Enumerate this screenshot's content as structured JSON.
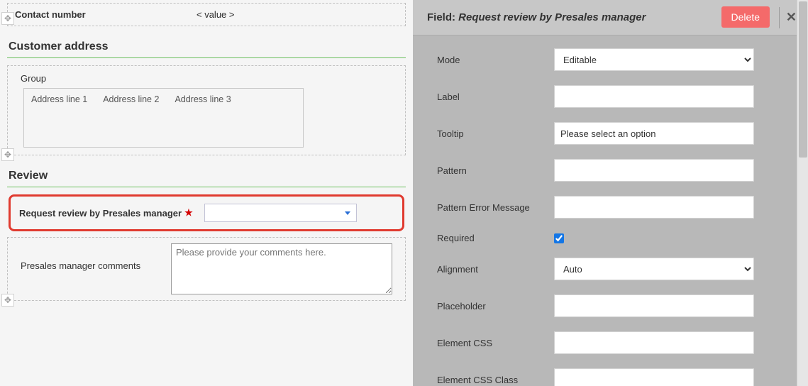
{
  "form": {
    "contact": {
      "label": "Contact number",
      "value_placeholder": "< value >"
    },
    "addr_section": {
      "title": "Customer address",
      "group_label": "Group",
      "lines": [
        "Address line 1",
        "Address line 2",
        "Address line 3"
      ]
    },
    "review_section": {
      "title": "Review",
      "request_label": "Request review by Presales manager",
      "comments_label": "Presales manager comments",
      "comments_placeholder": "Please provide your comments here."
    }
  },
  "props": {
    "title_prefix": "Field: ",
    "title_value": "Request review by Presales manager",
    "delete_label": "Delete",
    "rows": {
      "mode": {
        "label": "Mode",
        "value": "Editable"
      },
      "label": {
        "label": "Label",
        "value": ""
      },
      "tooltip": {
        "label": "Tooltip",
        "value": "Please select an option"
      },
      "pattern": {
        "label": "Pattern",
        "value": ""
      },
      "pattern_err": {
        "label": "Pattern Error Message",
        "value": ""
      },
      "required": {
        "label": "Required",
        "checked": true
      },
      "alignment": {
        "label": "Alignment",
        "value": "Auto"
      },
      "placeholder": {
        "label": "Placeholder",
        "value": ""
      },
      "element_css": {
        "label": "Element CSS",
        "value": ""
      },
      "element_css_class": {
        "label": "Element CSS Class",
        "value": ""
      }
    }
  }
}
